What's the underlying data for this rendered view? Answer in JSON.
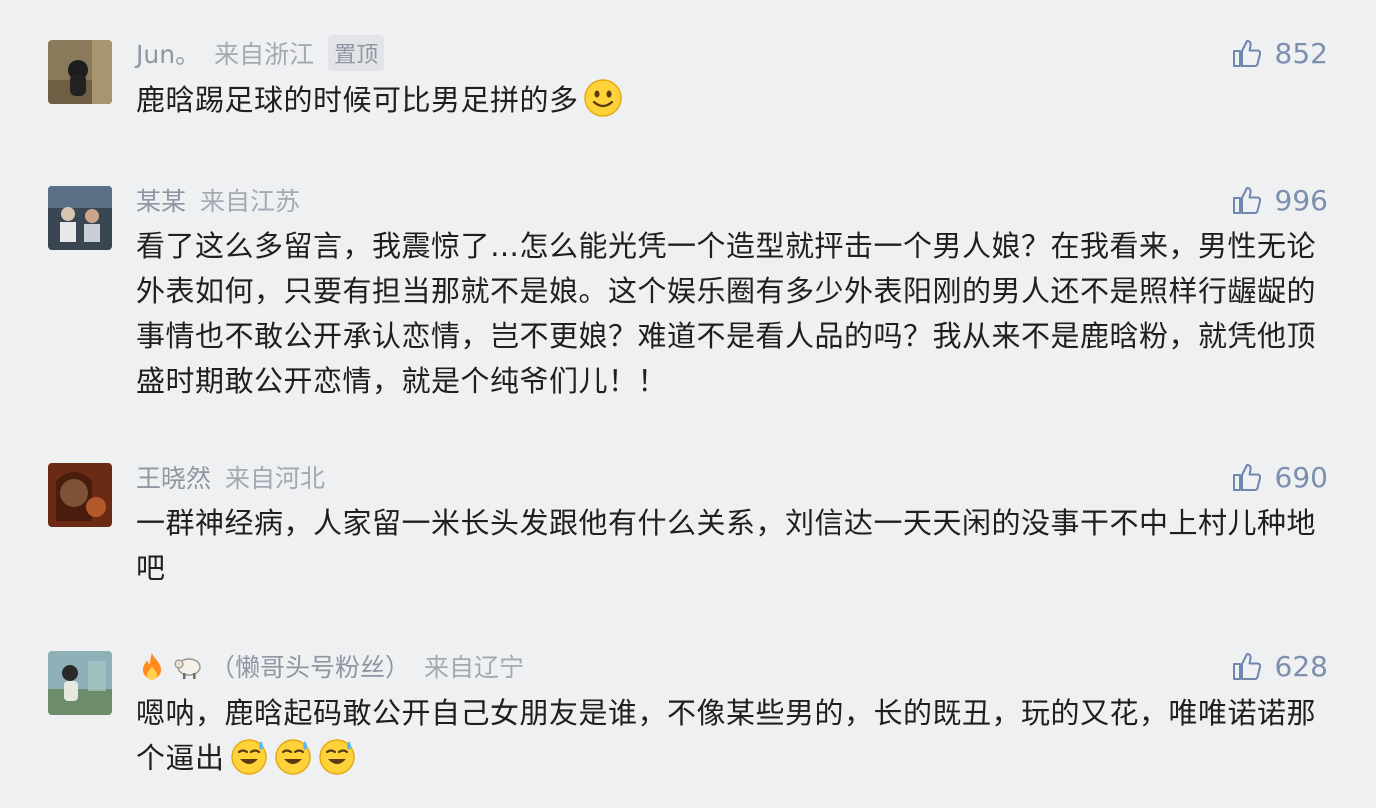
{
  "comments": [
    {
      "username": "Jun。",
      "location": "来自浙江",
      "pinned_label": "置顶",
      "likes": "852",
      "text": "鹿晗踢足球的时候可比男足拼的多",
      "emojis": [
        "smile-emoji"
      ]
    },
    {
      "username": "某某",
      "location": "来自江苏",
      "likes": "996",
      "text": "看了这么多留言，我震惊了…怎么能光凭一个造型就抨击一个男人娘？在我看来，男性无论外表如何，只要有担当那就不是娘。这个娱乐圈有多少外表阳刚的男人还不是照样行龌龊的事情也不敢公开承认恋情，岂不更娘？难道不是看人品的吗？我从来不是鹿晗粉，就凭他顶盛时期敢公开恋情，就是个纯爷们儿！！"
    },
    {
      "username": "王晓然",
      "location": "来自河北",
      "likes": "690",
      "text": "一群神经病，人家留一米长头发跟他有什么关系，刘信达一天天闲的没事干不中上村儿种地吧"
    },
    {
      "username": "（懒哥头号粉丝）",
      "username_icons": [
        "fire-icon",
        "sheep-icon"
      ],
      "location": "来自辽宁",
      "likes": "628",
      "text": "嗯呐，鹿晗起码敢公开自己女朋友是谁，不像某些男的，长的既丑，玩的又花，唯唯诺诺那个逼出",
      "emojis": [
        "sweat-smile-emoji",
        "sweat-smile-emoji",
        "sweat-smile-emoji"
      ]
    }
  ]
}
